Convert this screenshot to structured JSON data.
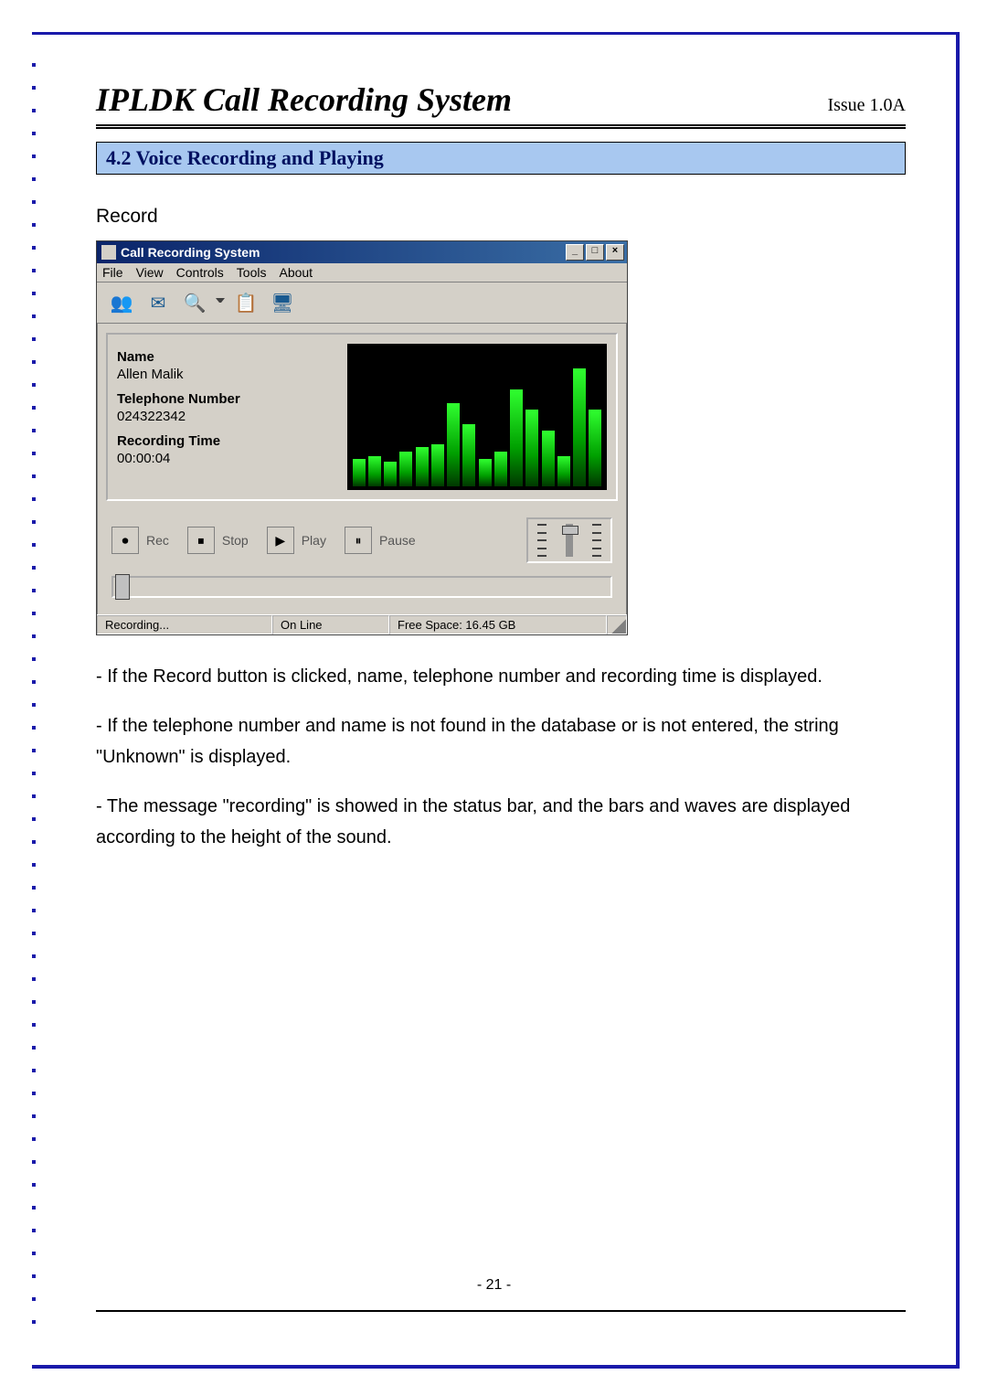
{
  "doc": {
    "title": "IPLDK Call Recording System",
    "issue": "Issue 1.0A",
    "section_heading": "4.2 Voice Recording and Playing",
    "subheading": "Record",
    "page_number": "- 21 -"
  },
  "app": {
    "window_title": "Call Recording System",
    "win_buttons": {
      "min": "_",
      "max": "□",
      "close": "×"
    },
    "menu": [
      "File",
      "View",
      "Controls",
      "Tools",
      "About"
    ],
    "toolbar_icons": [
      "users-icon",
      "mail-icon",
      "search-icon",
      "dropdown-icon",
      "list-icon",
      "device-icon"
    ],
    "fields": {
      "name_label": "Name",
      "name_value": "Allen Malik",
      "tel_label": "Telephone Number",
      "tel_value": "024322342",
      "time_label": "Recording Time",
      "time_value": "00:00:04"
    },
    "controls": {
      "rec": "Rec",
      "stop": "Stop",
      "play": "Play",
      "pause": "Pause"
    },
    "status": {
      "left": "Recording...",
      "mid": "On Line",
      "right": "Free Space: 16.45 GB"
    },
    "spectrum_bars_pct": [
      20,
      22,
      18,
      25,
      28,
      30,
      60,
      45,
      20,
      25,
      70,
      55,
      40,
      22,
      85,
      55
    ]
  },
  "paragraphs": [
    "- If the Record button is clicked, name, telephone number and recording time is displayed.",
    "- If the telephone number and name is not found in the database or is not entered, the string \"Unknown\" is displayed.",
    "- The message \"recording\" is showed in the status bar, and the bars and waves are displayed according to the height of the sound."
  ]
}
